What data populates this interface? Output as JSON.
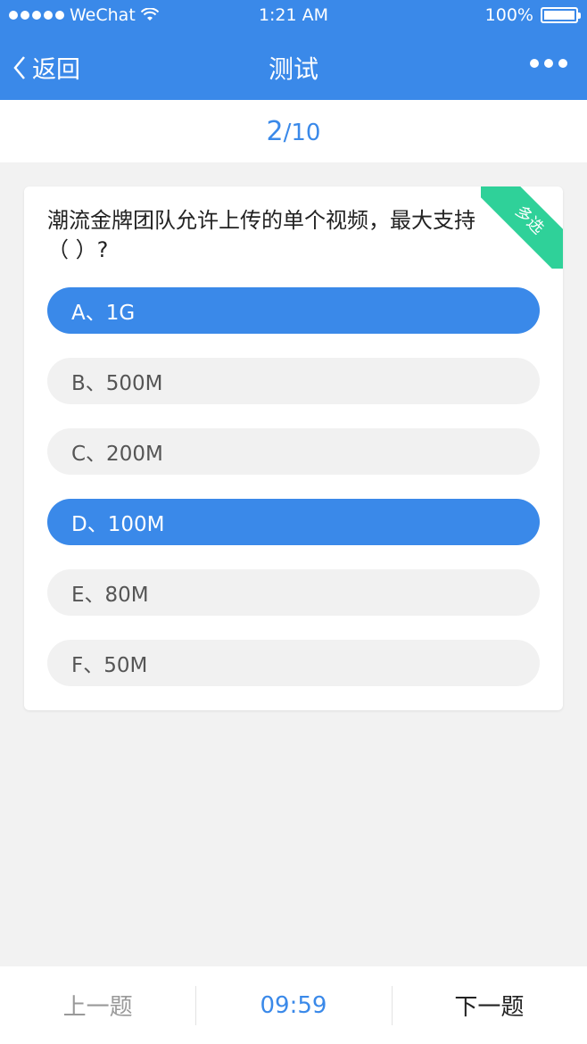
{
  "status_bar": {
    "carrier": "WeChat",
    "time": "1:21 AM",
    "battery": "100%",
    "battery_level": 1.0
  },
  "nav": {
    "back_label": "返回",
    "title": "测试"
  },
  "progress": {
    "current": "2",
    "total": "/10"
  },
  "question": {
    "badge": "多选",
    "text": "潮流金牌团队允许上传的单个视频，最大支持（ ）?",
    "options": [
      {
        "label": "A、1G",
        "selected": true
      },
      {
        "label": "B、500M",
        "selected": false
      },
      {
        "label": "C、200M",
        "selected": false
      },
      {
        "label": "D、100M",
        "selected": true
      },
      {
        "label": "E、80M",
        "selected": false
      },
      {
        "label": "F、50M",
        "selected": false
      }
    ]
  },
  "footer": {
    "prev_label": "上一题",
    "timer": "09:59",
    "next_label": "下一题"
  },
  "colors": {
    "primary": "#3a89e9",
    "badge": "#2fd199",
    "background": "#f2f2f2"
  }
}
